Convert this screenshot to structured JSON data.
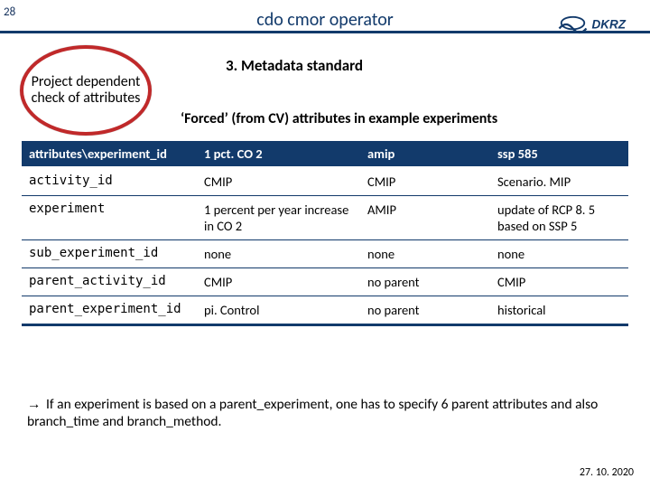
{
  "slide_number": "28",
  "title": "cdo cmor operator",
  "logo_text": "DKRZ",
  "ellipse_text": "Project dependent check of attributes",
  "heading3": "3. Metadata standard",
  "subheading": "‘Forced’ (from CV) attributes in example experiments",
  "table": {
    "headers": [
      "attributes\\experiment_id",
      "1 pct. CO 2",
      "amip",
      "ssp 585"
    ],
    "rows": [
      [
        "activity_id",
        "CMIP",
        "CMIP",
        "Scenario. MIP"
      ],
      [
        "experiment",
        "1 percent per year increase in CO 2",
        "AMIP",
        "update of RCP 8. 5 based on SSP 5"
      ],
      [
        "sub_experiment_id",
        "none",
        "none",
        "none"
      ],
      [
        "parent_activity_id",
        "CMIP",
        "no parent",
        "CMIP"
      ],
      [
        "parent_experiment_id",
        "pi. Control",
        "no parent",
        "historical"
      ]
    ]
  },
  "note_arrow": "→",
  "note": "If an experiment is based on a parent_experiment, one has to specify 6 parent attributes and also branch_time and branch_method.",
  "date": "27. 10. 2020"
}
